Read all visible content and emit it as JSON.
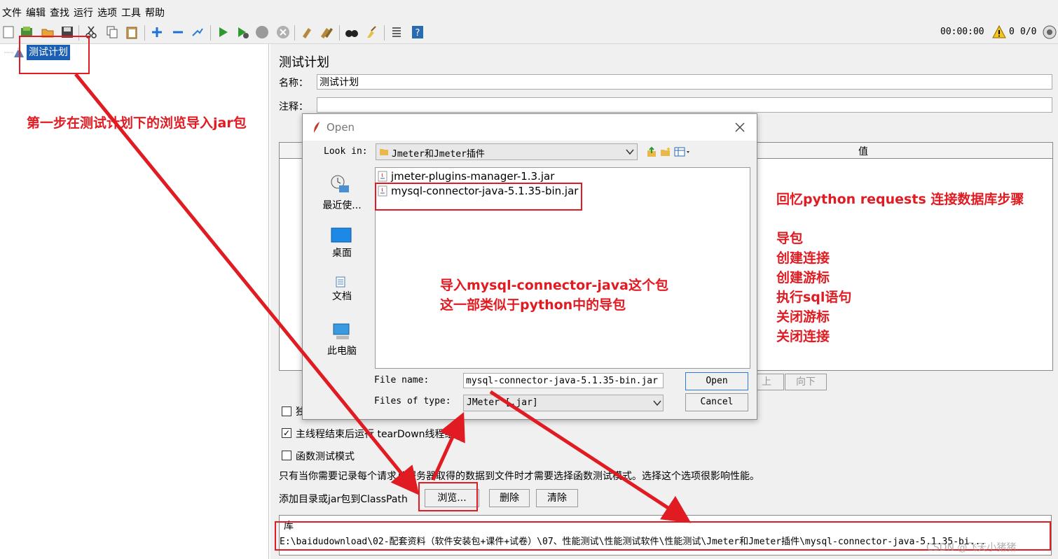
{
  "menu": [
    "文件",
    "编辑",
    "查找",
    "运行",
    "选项",
    "工具",
    "帮助"
  ],
  "status": {
    "timer": "00:00:00",
    "warnings": "0",
    "threads": "0/0"
  },
  "tree": {
    "root_label": "测试计划"
  },
  "panel": {
    "title": "测试计划",
    "name_label": "名称：",
    "name_value": "测试计划",
    "comment_label": "注释：",
    "comment_value": "",
    "table_header_value": "值",
    "up_button": "上",
    "down_button": "向下",
    "checkbox_hidden_partial": "独",
    "teardown_label": "主线程结束后运行 tearDown线程组",
    "functional_label": "函数测试模式",
    "functional_note": "只有当你需要记录每个请求从服务器取得的数据到文件时才需要选择函数测试模式。选择这个选项很影响性能。",
    "classpath_label": "添加目录或jar包到ClassPath",
    "browse_button": "浏览...",
    "delete_button": "删除",
    "clear_button": "清除",
    "lib_header": "库",
    "lib_path": "E:\\baidudownload\\02-配套资料（软件安装包+课件+试卷）\\07、性能测试\\性能测试软件\\性能测试\\Jmeter和Jmeter插件\\mysql-connector-java-5.1.35-bi..."
  },
  "dialog": {
    "title": "Open",
    "look_in_label": "Look in:",
    "look_in_value": "Jmeter和Jmeter插件",
    "places": [
      "最近使...",
      "桌面",
      "文档",
      "此电脑"
    ],
    "files": [
      "jmeter-plugins-manager-1.3.jar",
      "mysql-connector-java-5.1.35-bin.jar"
    ],
    "file_name_label": "File name:",
    "file_name_value": "mysql-connector-java-5.1.35-bin.jar",
    "file_type_label": "Files of type:",
    "file_type_value": "JMeter [.jar]",
    "open_button": "Open",
    "cancel_button": "Cancel"
  },
  "annotations": {
    "step1": "第一步在测试计划下的浏览导入jar包",
    "import_line1": "导入mysql-connector-java这个包",
    "import_line2": "这一部类似于python中的导包",
    "recall_title": "回忆python requests 连接数据库步骤",
    "recall_steps": [
      "导包",
      "创建连接",
      "创建游标",
      "执行sql语句",
      "关闭游标",
      "关闭连接"
    ]
  },
  "watermark": "CSDN @飞天小猪猪",
  "colors": {
    "accent_red": "#e11b22",
    "selection_blue": "#1a5fb4"
  }
}
